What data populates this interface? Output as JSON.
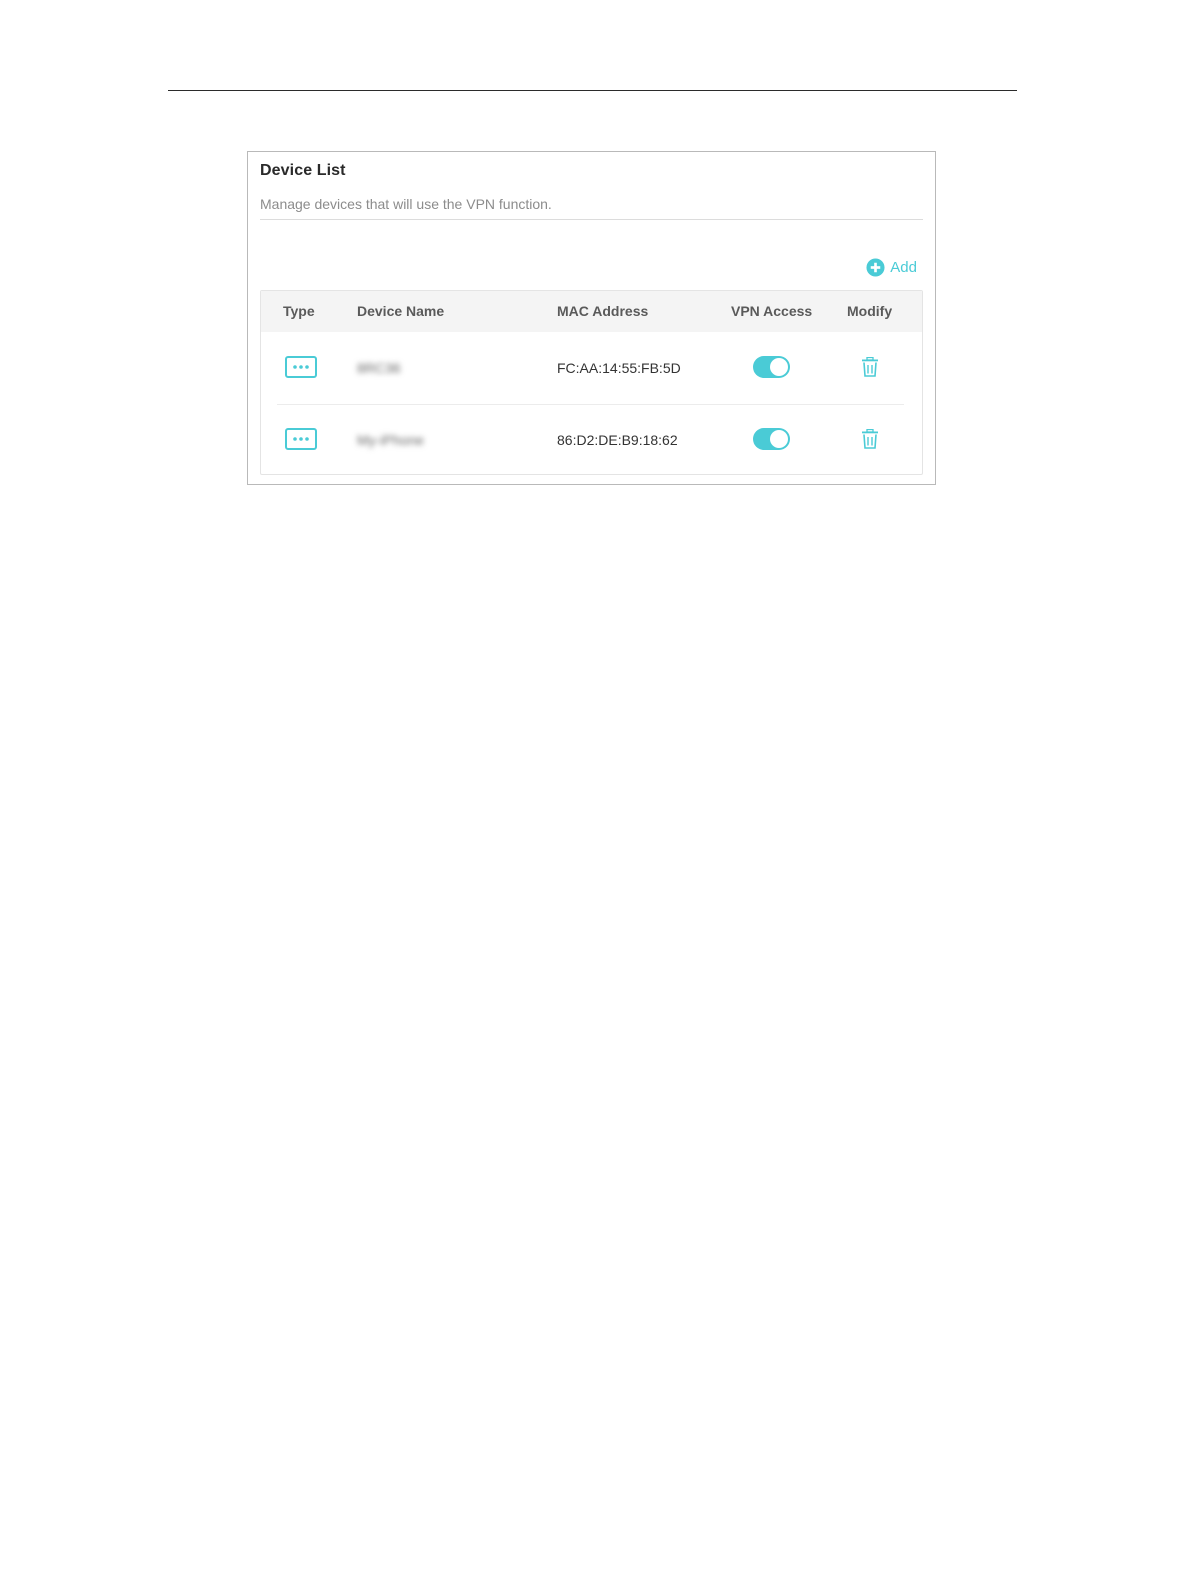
{
  "panel": {
    "title": "Device List",
    "description": "Manage devices that will use the VPN function.",
    "add_label": "Add"
  },
  "table": {
    "headers": {
      "type": "Type",
      "device_name": "Device Name",
      "mac_address": "MAC Address",
      "vpn_access": "VPN Access",
      "modify": "Modify"
    },
    "rows": [
      {
        "type_icon": "other-device-icon",
        "device_name": "8RC36",
        "mac_address": "FC:AA:14:55:FB:5D",
        "vpn_access": true,
        "modify_icon": "trash-icon"
      },
      {
        "type_icon": "other-device-icon",
        "device_name": "My-iPhone",
        "mac_address": "86:D2:DE:B9:18:62",
        "vpn_access": true,
        "modify_icon": "trash-icon"
      }
    ]
  },
  "colors": {
    "accent": "#4acbd6",
    "header_bg": "#f4f4f4",
    "border": "#b9b9b9"
  }
}
